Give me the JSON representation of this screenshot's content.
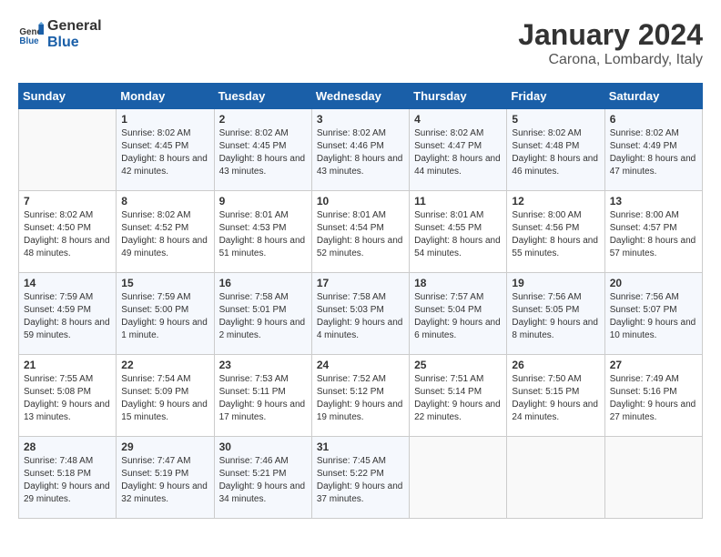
{
  "header": {
    "logo_line1": "General",
    "logo_line2": "Blue",
    "month": "January 2024",
    "location": "Carona, Lombardy, Italy"
  },
  "weekdays": [
    "Sunday",
    "Monday",
    "Tuesday",
    "Wednesday",
    "Thursday",
    "Friday",
    "Saturday"
  ],
  "weeks": [
    [
      {
        "day": "",
        "sunrise": "",
        "sunset": "",
        "daylight": ""
      },
      {
        "day": "1",
        "sunrise": "Sunrise: 8:02 AM",
        "sunset": "Sunset: 4:45 PM",
        "daylight": "Daylight: 8 hours and 42 minutes."
      },
      {
        "day": "2",
        "sunrise": "Sunrise: 8:02 AM",
        "sunset": "Sunset: 4:45 PM",
        "daylight": "Daylight: 8 hours and 43 minutes."
      },
      {
        "day": "3",
        "sunrise": "Sunrise: 8:02 AM",
        "sunset": "Sunset: 4:46 PM",
        "daylight": "Daylight: 8 hours and 43 minutes."
      },
      {
        "day": "4",
        "sunrise": "Sunrise: 8:02 AM",
        "sunset": "Sunset: 4:47 PM",
        "daylight": "Daylight: 8 hours and 44 minutes."
      },
      {
        "day": "5",
        "sunrise": "Sunrise: 8:02 AM",
        "sunset": "Sunset: 4:48 PM",
        "daylight": "Daylight: 8 hours and 46 minutes."
      },
      {
        "day": "6",
        "sunrise": "Sunrise: 8:02 AM",
        "sunset": "Sunset: 4:49 PM",
        "daylight": "Daylight: 8 hours and 47 minutes."
      }
    ],
    [
      {
        "day": "7",
        "sunrise": "Sunrise: 8:02 AM",
        "sunset": "Sunset: 4:50 PM",
        "daylight": "Daylight: 8 hours and 48 minutes."
      },
      {
        "day": "8",
        "sunrise": "Sunrise: 8:02 AM",
        "sunset": "Sunset: 4:52 PM",
        "daylight": "Daylight: 8 hours and 49 minutes."
      },
      {
        "day": "9",
        "sunrise": "Sunrise: 8:01 AM",
        "sunset": "Sunset: 4:53 PM",
        "daylight": "Daylight: 8 hours and 51 minutes."
      },
      {
        "day": "10",
        "sunrise": "Sunrise: 8:01 AM",
        "sunset": "Sunset: 4:54 PM",
        "daylight": "Daylight: 8 hours and 52 minutes."
      },
      {
        "day": "11",
        "sunrise": "Sunrise: 8:01 AM",
        "sunset": "Sunset: 4:55 PM",
        "daylight": "Daylight: 8 hours and 54 minutes."
      },
      {
        "day": "12",
        "sunrise": "Sunrise: 8:00 AM",
        "sunset": "Sunset: 4:56 PM",
        "daylight": "Daylight: 8 hours and 55 minutes."
      },
      {
        "day": "13",
        "sunrise": "Sunrise: 8:00 AM",
        "sunset": "Sunset: 4:57 PM",
        "daylight": "Daylight: 8 hours and 57 minutes."
      }
    ],
    [
      {
        "day": "14",
        "sunrise": "Sunrise: 7:59 AM",
        "sunset": "Sunset: 4:59 PM",
        "daylight": "Daylight: 8 hours and 59 minutes."
      },
      {
        "day": "15",
        "sunrise": "Sunrise: 7:59 AM",
        "sunset": "Sunset: 5:00 PM",
        "daylight": "Daylight: 9 hours and 1 minute."
      },
      {
        "day": "16",
        "sunrise": "Sunrise: 7:58 AM",
        "sunset": "Sunset: 5:01 PM",
        "daylight": "Daylight: 9 hours and 2 minutes."
      },
      {
        "day": "17",
        "sunrise": "Sunrise: 7:58 AM",
        "sunset": "Sunset: 5:03 PM",
        "daylight": "Daylight: 9 hours and 4 minutes."
      },
      {
        "day": "18",
        "sunrise": "Sunrise: 7:57 AM",
        "sunset": "Sunset: 5:04 PM",
        "daylight": "Daylight: 9 hours and 6 minutes."
      },
      {
        "day": "19",
        "sunrise": "Sunrise: 7:56 AM",
        "sunset": "Sunset: 5:05 PM",
        "daylight": "Daylight: 9 hours and 8 minutes."
      },
      {
        "day": "20",
        "sunrise": "Sunrise: 7:56 AM",
        "sunset": "Sunset: 5:07 PM",
        "daylight": "Daylight: 9 hours and 10 minutes."
      }
    ],
    [
      {
        "day": "21",
        "sunrise": "Sunrise: 7:55 AM",
        "sunset": "Sunset: 5:08 PM",
        "daylight": "Daylight: 9 hours and 13 minutes."
      },
      {
        "day": "22",
        "sunrise": "Sunrise: 7:54 AM",
        "sunset": "Sunset: 5:09 PM",
        "daylight": "Daylight: 9 hours and 15 minutes."
      },
      {
        "day": "23",
        "sunrise": "Sunrise: 7:53 AM",
        "sunset": "Sunset: 5:11 PM",
        "daylight": "Daylight: 9 hours and 17 minutes."
      },
      {
        "day": "24",
        "sunrise": "Sunrise: 7:52 AM",
        "sunset": "Sunset: 5:12 PM",
        "daylight": "Daylight: 9 hours and 19 minutes."
      },
      {
        "day": "25",
        "sunrise": "Sunrise: 7:51 AM",
        "sunset": "Sunset: 5:14 PM",
        "daylight": "Daylight: 9 hours and 22 minutes."
      },
      {
        "day": "26",
        "sunrise": "Sunrise: 7:50 AM",
        "sunset": "Sunset: 5:15 PM",
        "daylight": "Daylight: 9 hours and 24 minutes."
      },
      {
        "day": "27",
        "sunrise": "Sunrise: 7:49 AM",
        "sunset": "Sunset: 5:16 PM",
        "daylight": "Daylight: 9 hours and 27 minutes."
      }
    ],
    [
      {
        "day": "28",
        "sunrise": "Sunrise: 7:48 AM",
        "sunset": "Sunset: 5:18 PM",
        "daylight": "Daylight: 9 hours and 29 minutes."
      },
      {
        "day": "29",
        "sunrise": "Sunrise: 7:47 AM",
        "sunset": "Sunset: 5:19 PM",
        "daylight": "Daylight: 9 hours and 32 minutes."
      },
      {
        "day": "30",
        "sunrise": "Sunrise: 7:46 AM",
        "sunset": "Sunset: 5:21 PM",
        "daylight": "Daylight: 9 hours and 34 minutes."
      },
      {
        "day": "31",
        "sunrise": "Sunrise: 7:45 AM",
        "sunset": "Sunset: 5:22 PM",
        "daylight": "Daylight: 9 hours and 37 minutes."
      },
      {
        "day": "",
        "sunrise": "",
        "sunset": "",
        "daylight": ""
      },
      {
        "day": "",
        "sunrise": "",
        "sunset": "",
        "daylight": ""
      },
      {
        "day": "",
        "sunrise": "",
        "sunset": "",
        "daylight": ""
      }
    ]
  ]
}
